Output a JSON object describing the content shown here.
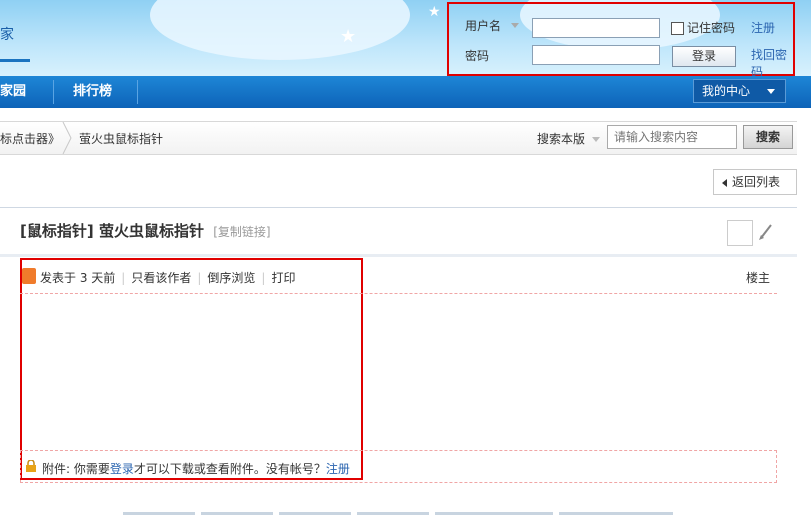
{
  "header": {
    "logo_text": "家",
    "login": {
      "username_label": "用户名",
      "password_label": "密码",
      "remember_label": "记住密码",
      "register_link": "注册",
      "forgot_link": "找回密码",
      "login_button": "登录",
      "username_value": "",
      "password_value": ""
    }
  },
  "nav": {
    "items": [
      "家园",
      "排行榜"
    ],
    "my_center": "我的中心"
  },
  "breadcrumb": {
    "items": [
      "标点击器》",
      "萤火虫鼠标指针"
    ],
    "search_scope": "搜索本版",
    "search_placeholder": "请输入搜索内容",
    "search_button": "搜索"
  },
  "back_button": "返回列表",
  "post": {
    "category": "[鼠标指针]",
    "title": "萤火虫鼠标指针",
    "copy_link": "[复制链接]",
    "meta": {
      "posted": "发表于 3 天前",
      "only_author": "只看该作者",
      "reverse": "倒序浏览",
      "print": "打印"
    },
    "floor": "楼主",
    "attachment": {
      "prefix": "附件: 你需要",
      "login_link": "登录",
      "middle": "才可以下载或查看附件。没有帐号？",
      "register_link": "注册"
    }
  },
  "colors": {
    "nav_blue": "#0d63b8",
    "link_blue": "#2b65b0",
    "highlight_red": "#e00000"
  }
}
